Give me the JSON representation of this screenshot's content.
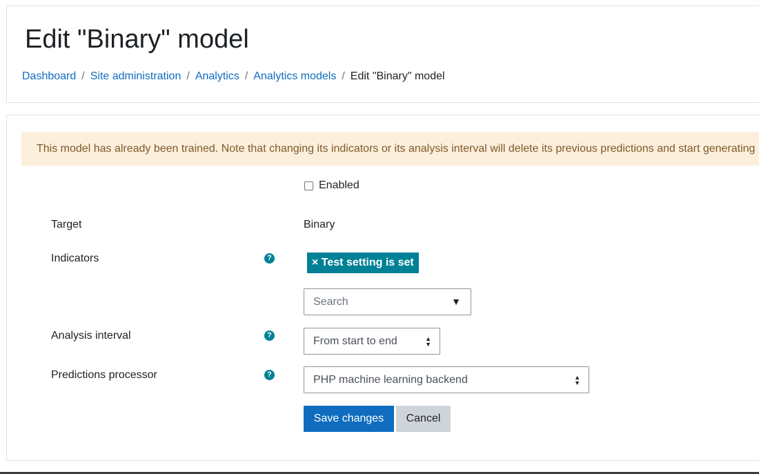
{
  "header": {
    "title": "Edit \"Binary\" model",
    "breadcrumb": [
      {
        "label": "Dashboard"
      },
      {
        "label": "Site administration"
      },
      {
        "label": "Analytics"
      },
      {
        "label": "Analytics models"
      },
      {
        "label": "Edit \"Binary\" model"
      }
    ],
    "separator": "/"
  },
  "alert": {
    "message": "This model has already been trained. Note that changing its indicators or its analysis interval will delete its previous predictions and start generating new ones."
  },
  "form": {
    "enabled": {
      "label": "Enabled",
      "checked": false
    },
    "target": {
      "label": "Target",
      "value": "Binary"
    },
    "indicators": {
      "label": "Indicators",
      "help_icon": "?",
      "selected_tag": "× Test setting is set",
      "search_placeholder": "Search",
      "dropdown_arrow": "▼"
    },
    "analysis_interval": {
      "label": "Analysis interval",
      "help_icon": "?",
      "value": "From start to end"
    },
    "predictions_processor": {
      "label": "Predictions processor",
      "help_icon": "?",
      "value": "PHP machine learning backend"
    },
    "buttons": {
      "save": "Save changes",
      "cancel": "Cancel"
    }
  },
  "colors": {
    "link": "#0f6cbf",
    "primary": "#0f6cbf",
    "teal": "#008196",
    "alert_bg": "#fcefdc",
    "alert_text": "#7d5a29"
  }
}
